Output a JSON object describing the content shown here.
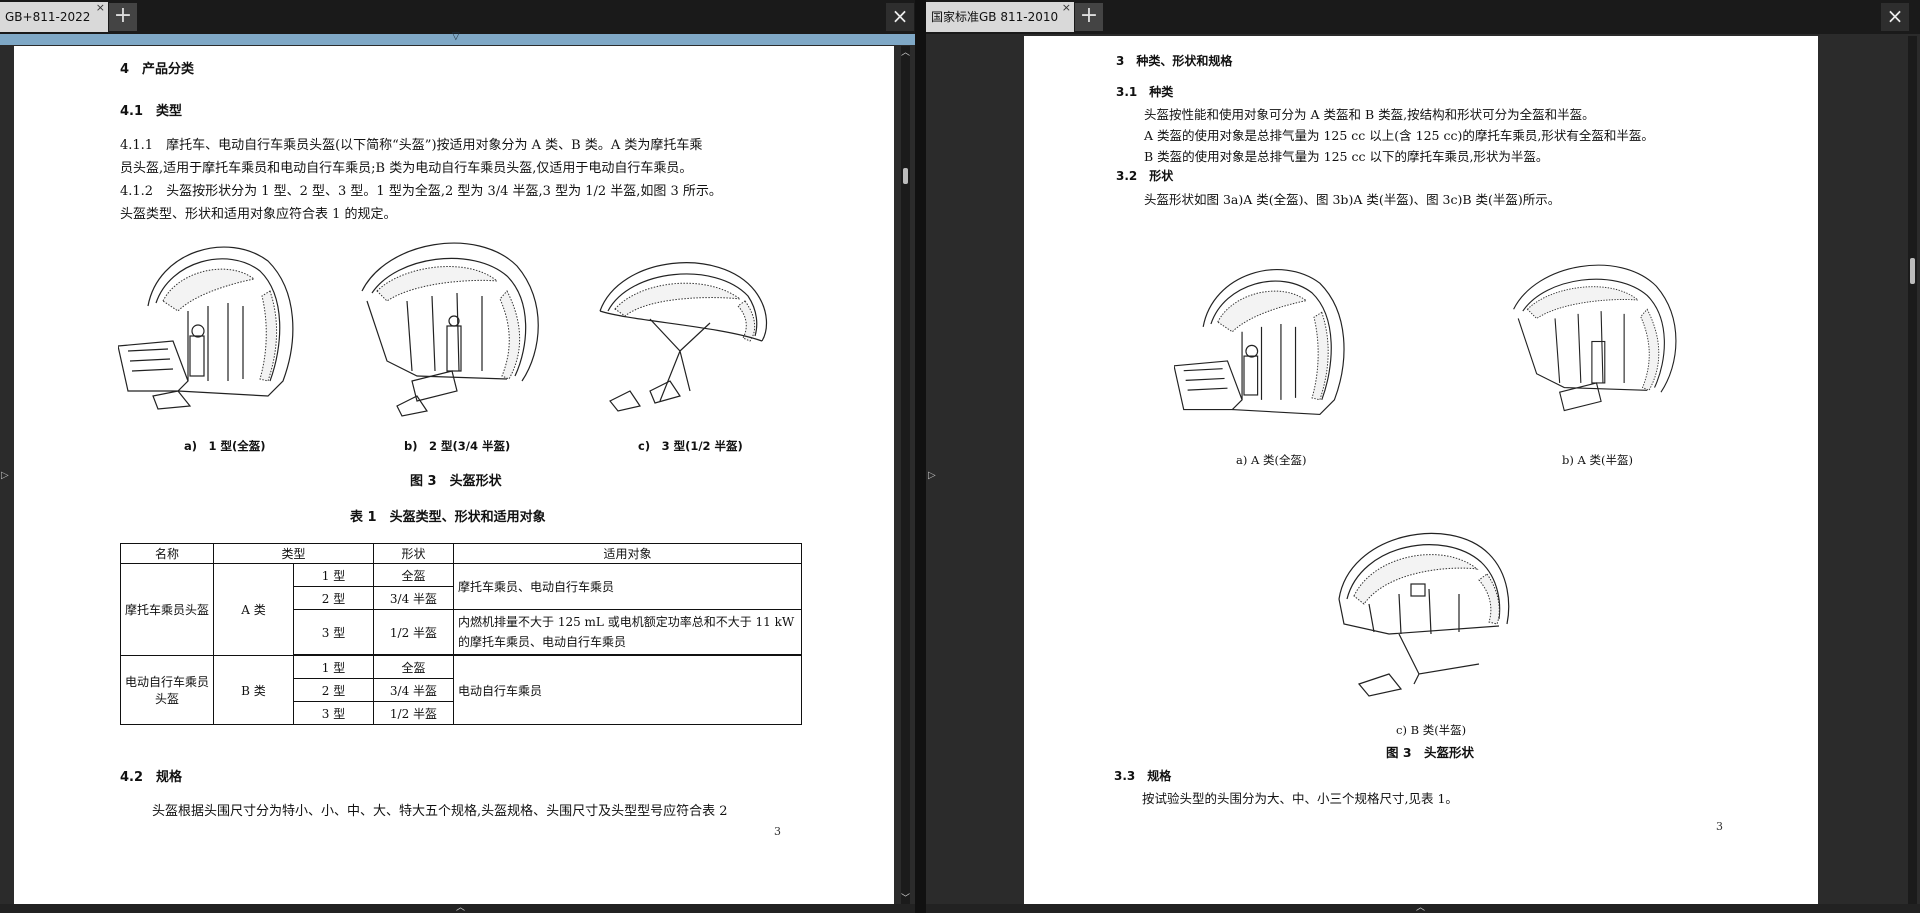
{
  "left": {
    "tab_title": "GB+811-2022",
    "tab_close": "×",
    "new_tab": "+",
    "close_pane": "×",
    "collapse_arrow": "▽",
    "page": {
      "h4": "4　产品分类",
      "h41": "4.1　类型",
      "p411_line1": "4.1.1　摩托车、电动自行车乘员头盔(以下简称“头盔”)按适用对象分为 A 类、B 类。A 类为摩托车乘",
      "p411_line2": "员头盔,适用于摩托车乘员和电动自行车乘员;B 类为电动自行车乘员头盔,仅适用于电动自行车乘员。",
      "p412_line1": "4.1.2　头盔按形状分为 1 型、2 型、3 型。1 型为全盔,2 型为 3/4 半盔,3 型为 1/2 半盔,如图 3 所示。",
      "p412_line2": "头盔类型、形状和适用对象应符合表 1 的规定。",
      "fig_a": "a)　1 型(全盔)",
      "fig_b": "b)　2 型(3/4 半盔)",
      "fig_c": "c)　3 型(1/2 半盔)",
      "fig_title": "图 3　头盔形状",
      "table_title": "表 1　头盔类型、形状和适用对象",
      "table": {
        "headers": [
          "名称",
          "类型",
          "形状",
          "适用对象"
        ],
        "group_a_name": "摩托车乘员头盔",
        "group_a_class": "A 类",
        "group_b_name": "电动自行车乘员头盔",
        "group_b_class": "B 类",
        "a_rows": [
          {
            "type": "1 型",
            "shape": "全盔"
          },
          {
            "type": "2 型",
            "shape": "3/4 半盔"
          },
          {
            "type": "3 型",
            "shape": "1/2 半盔"
          }
        ],
        "a_use_12": "摩托车乘员、电动自行车乘员",
        "a_use_3": "内燃机排量不大于 125 mL 或电机额定功率总和不大于 11 kW 的摩托车乘员、电动自行车乘员",
        "b_rows": [
          {
            "type": "1 型",
            "shape": "全盔"
          },
          {
            "type": "2 型",
            "shape": "3/4 半盔"
          },
          {
            "type": "3 型",
            "shape": "1/2 半盔"
          }
        ],
        "b_use": "电动自行车乘员"
      },
      "h42": "4.2　规格",
      "p42": "头盔根据头围尺寸分为特小、小、中、大、特大五个规格,头盔规格、头围尺寸及头型型号应符合表 2",
      "page_number": "3"
    }
  },
  "right": {
    "tab_title": "国家标准GB 811-2010",
    "tab_close": "×",
    "new_tab": "+",
    "close_pane": "×",
    "page": {
      "h3": "3　种类、形状和规格",
      "h31": "3.1　种类",
      "p31a": "头盔按性能和使用对象可分为 A 类盔和 B 类盔,按结构和形状可分为全盔和半盔。",
      "p31b": "A 类盔的使用对象是总排气量为 125 cc 以上(含 125 cc)的摩托车乘员,形状有全盔和半盔。",
      "p31c": "B 类盔的使用对象是总排气量为 125 cc 以下的摩托车乘员,形状为半盔。",
      "h32": "3.2　形状",
      "p32": "头盔形状如图 3a)A 类(全盔)、图 3b)A 类(半盔)、图 3c)B 类(半盔)所示。",
      "fig_a": "a) A 类(全盔)",
      "fig_b": "b) A 类(半盔)",
      "fig_c": "c) B 类(半盔)",
      "fig_title": "图 3　头盔形状",
      "h33": "3.3　规格",
      "p33": "按试验头型的头围分为大、中、小三个规格尺寸,见表 1。",
      "page_number": "3"
    }
  },
  "icons": {
    "left_side_arrow": "▷",
    "right_side_arrow": "▷",
    "scroll_up": "︿",
    "scroll_down": "﹀",
    "bottom_arrow": "︿"
  }
}
